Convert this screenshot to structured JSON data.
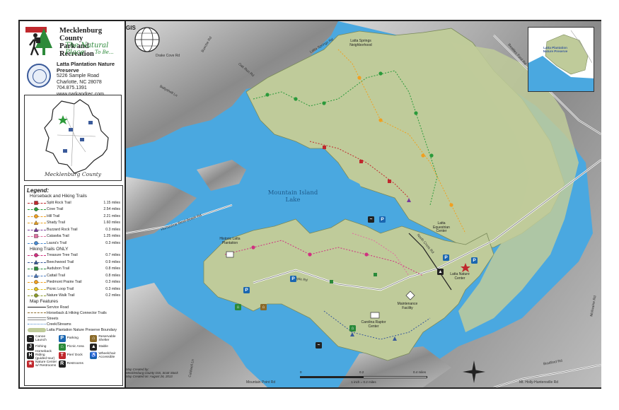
{
  "organization": {
    "name_line1": "Mecklenburg County",
    "name_line2": "Park and Recreation",
    "tagline": "The Natural Place",
    "tagline2": "To Be..."
  },
  "preserve": {
    "name": "Latta Plantation Nature Preserve",
    "address1": "5226 Sample Road",
    "address2": "Charlotte, NC 28078",
    "phone": "704.875.1391",
    "website": "www.parkandrec.com"
  },
  "county_map": {
    "label": "Mecklenburg County"
  },
  "legend": {
    "title": "Legend:",
    "group1_title": "Horseback and Hiking Trails",
    "group1": [
      {
        "name": "Split Rock Trail",
        "distance": "1.15 miles",
        "color": "#c0282d",
        "marker": "square"
      },
      {
        "name": "Cove Trail",
        "distance": "2.54 miles",
        "color": "#2a9a3a",
        "marker": "circle"
      },
      {
        "name": "Hill Trail",
        "distance": "2.21 miles",
        "color": "#f0a020",
        "marker": "circle"
      },
      {
        "name": "Shady Trail",
        "distance": "1.60 miles",
        "color": "#e8a020",
        "marker": "triangle"
      },
      {
        "name": "Buzzard Rock Trail",
        "distance": "0.3 miles",
        "color": "#7a3a9a",
        "marker": "triangle"
      },
      {
        "name": "Catawba Trail",
        "distance": "1.25 miles",
        "color": "#e070a0",
        "marker": "square"
      },
      {
        "name": "Laura's Trail",
        "distance": "0.3 miles",
        "color": "#4a8ad0",
        "marker": "circle"
      }
    ],
    "group2_title": "Hiking Trails ONLY",
    "group2": [
      {
        "name": "Treasure Tree Trail",
        "distance": "0.7 miles",
        "color": "#d03080",
        "marker": "circle"
      },
      {
        "name": "Beechwood Trail",
        "distance": "0.9 miles",
        "color": "#3a5a9a",
        "marker": "triangle"
      },
      {
        "name": "Audubon Trail",
        "distance": "0.8 miles",
        "color": "#2a8a3a",
        "marker": "square"
      },
      {
        "name": "Cattail Trail",
        "distance": "0.8 miles",
        "color": "#4a7ac0",
        "marker": "triangle"
      },
      {
        "name": "Piedmont Prairie Trail",
        "distance": "0.3 miles",
        "color": "#f0a020",
        "marker": "circle"
      },
      {
        "name": "Picnic Loop Trail",
        "distance": "0.3 miles",
        "color": "#e0c020",
        "marker": "circle"
      },
      {
        "name": "Nature Walk Trail",
        "distance": "0.2 miles",
        "color": "#8a9a2a",
        "marker": "circle"
      }
    ],
    "map_features_title": "Map Features",
    "features": [
      {
        "name": "Service Road",
        "style": "solid-black"
      },
      {
        "name": "Horseback & Hiking Connector Trails",
        "style": "dashed-brown"
      },
      {
        "name": "Streets",
        "style": "double-gray"
      },
      {
        "name": "Creek/Streams",
        "style": "blue-dotted"
      },
      {
        "name": "Latta Plantation Nature Preserve Boundary",
        "style": "green-fill"
      }
    ],
    "facilities": [
      {
        "name": "Canoe Launch",
        "icon": "canoe-icon",
        "color": "#222222"
      },
      {
        "name": "Parking",
        "icon": "parking-icon",
        "color": "#1a66b0"
      },
      {
        "name": "Reservable Shelter",
        "icon": "shelter-icon",
        "color": "#8a6a2a"
      },
      {
        "name": "Fishing",
        "icon": "fishing-icon",
        "color": "#222222"
      },
      {
        "name": "Picnic Area",
        "icon": "picnic-icon",
        "color": "#2a8a3a"
      },
      {
        "name": "Stable",
        "icon": "stable-icon",
        "color": "#222222"
      },
      {
        "name": "Horseback Riding (guided tour)",
        "icon": "horse-icon",
        "color": "#222222"
      },
      {
        "name": "Pier/ Dock",
        "icon": "pier-icon",
        "color": "#c0282d"
      },
      {
        "name": "Wheelchair Accessible",
        "icon": "wheelchair-icon",
        "color": "#1a66b0"
      },
      {
        "name": "Nature Center w/ Restrooms",
        "icon": "star-icon",
        "color": "#c0282d"
      },
      {
        "name": "Restrooms",
        "icon": "restroom-icon",
        "color": "#222222"
      }
    ]
  },
  "map": {
    "lake_label": "Mountain Island Lake",
    "roads": [
      "Drake Cove Rd",
      "Bueche Rd",
      "Oak Run Rd",
      "Latta Springs Rd",
      "Beatties Ford Rd",
      "Ballyshell Ln",
      "Horseshoe Bend Beach Rd",
      "Sample Rd",
      "North Cross Rd",
      "Bradford Rd",
      "Mt. Holly-Huntersville Rd",
      "Mountain Point Rd",
      "Mcilwaine Rd",
      "Caldwell Ln"
    ],
    "places": {
      "latta_springs": "Latta Springs Neighborhood",
      "historic": "Historic Latta Plantation",
      "equestrian": "Latta Equestrian Center",
      "maintenance": "Maintenance Facility",
      "raptor": "Carolina Raptor Center",
      "nature_center": "Latta Nature Center"
    },
    "inset_label": "Latta Plantation Nature Preserve",
    "credit": [
      "Map Created by:",
      "Mecklenburg County GIS, Scott Stock",
      "Map Created on: August 26, 2013"
    ],
    "scale": {
      "ticks": [
        "0",
        "0.2",
        "0.4 miles"
      ],
      "caption": "1 inch = 0.2 miles"
    },
    "colors": {
      "water": "#4aa8e0",
      "preserve": "#bfcb9a",
      "terrain": "#9a9a9a"
    }
  }
}
